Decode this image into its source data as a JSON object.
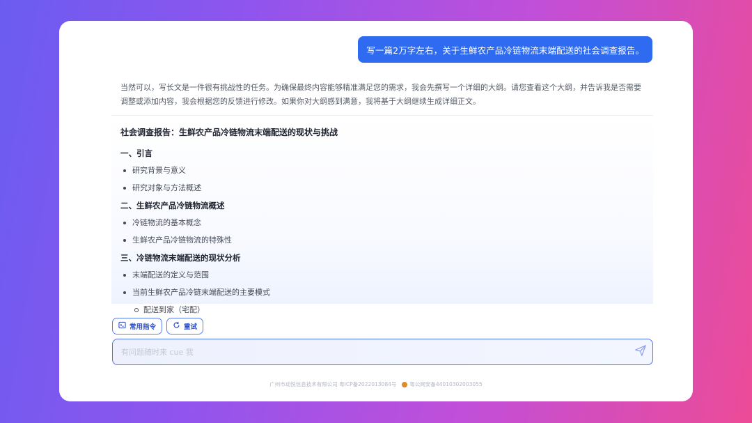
{
  "user_message": "写一篇2万字左右，关于生鲜农产品冷链物流末端配送的社会调查报告。",
  "reply": {
    "intro": "当然可以，写长文是一件很有挑战性的任务。为确保最终内容能够精准满足您的需求，我会先撰写一个详细的大纲。请您查看这个大纲，并告诉我是否需要调整或添加内容，我会根据您的反馈进行修改。如果你对大纲感到满意，我将基于大纲继续生成详细正文。",
    "outline_title": "社会调查报告：生鲜农产品冷链物流末端配送的现状与挑战",
    "sections": [
      {
        "title": "一、引言",
        "items": [
          "研究背景与意义",
          "研究对象与方法概述"
        ]
      },
      {
        "title": "二、生鲜农产品冷链物流概述",
        "items": [
          "冷链物流的基本概念",
          "生鲜农产品冷链物流的特殊性"
        ]
      },
      {
        "title": "三、冷链物流末端配送的现状分析",
        "items": [
          "末端配送的定义与范围",
          "当前生鲜农产品冷链末端配送的主要模式"
        ],
        "subitems": [
          "配送到家（宅配）"
        ]
      }
    ]
  },
  "actions": {
    "common_commands": "常用指令",
    "retry": "重试"
  },
  "input": {
    "placeholder": "有问题随时来 cue 我",
    "value": ""
  },
  "footer": {
    "company": "广州市动悦信息技术有限公司 粤ICP备2022013084号",
    "police": "粤公网安备44010302003055"
  },
  "colors": {
    "accent": "#2f6bf0",
    "border": "#4d6ef0"
  },
  "icons": {
    "common_commands": "command-icon",
    "retry": "refresh-icon",
    "send": "send-icon",
    "police": "police-badge-icon"
  }
}
